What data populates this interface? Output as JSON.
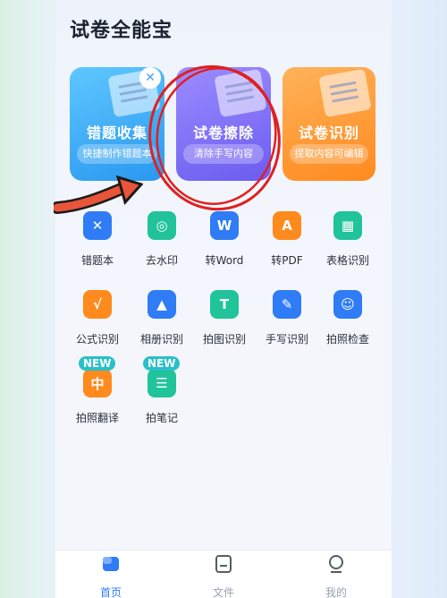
{
  "app": {
    "title": "试卷全能宝"
  },
  "feature_cards": [
    {
      "title": "错题收集",
      "subtitle": "快捷制作错题本"
    },
    {
      "title": "试卷擦除",
      "subtitle": "清除手写内容"
    },
    {
      "title": "试卷识别",
      "subtitle": "提取内容可编辑"
    }
  ],
  "tools": [
    {
      "label": "错题本",
      "icon": "x-notebook-icon",
      "color": "#2f7cf6"
    },
    {
      "label": "去水印",
      "icon": "watermark-brush-icon",
      "color": "#21c39a"
    },
    {
      "label": "转Word",
      "icon": "word-icon",
      "color": "#2f7cf6"
    },
    {
      "label": "转PDF",
      "icon": "pdf-icon",
      "color": "#ff8a1e"
    },
    {
      "label": "表格识别",
      "icon": "table-icon",
      "color": "#21c39a"
    },
    {
      "label": "公式识别",
      "icon": "formula-icon",
      "color": "#ff8a1e"
    },
    {
      "label": "相册识别",
      "icon": "album-icon",
      "color": "#2f7cf6"
    },
    {
      "label": "拍图识别",
      "icon": "text-t-icon",
      "color": "#21c39a"
    },
    {
      "label": "手写识别",
      "icon": "handwriting-pen-icon",
      "color": "#2f7cf6"
    },
    {
      "label": "拍照检查",
      "icon": "camera-check-icon",
      "color": "#2f7cf6"
    },
    {
      "label": "拍照翻译",
      "icon": "translate-icon",
      "color": "#ff8a1e",
      "badge": "NEW"
    },
    {
      "label": "拍笔记",
      "icon": "note-icon",
      "color": "#21c39a",
      "badge": "NEW"
    }
  ],
  "bottom_nav": [
    {
      "label": "首页",
      "icon": "home-icon",
      "active": true
    },
    {
      "label": "文件",
      "icon": "file-icon",
      "active": false
    },
    {
      "label": "我的",
      "icon": "profile-icon",
      "active": false
    }
  ],
  "colors": {
    "accent": "#2f7cf6",
    "annotation_red": "#e02020"
  }
}
